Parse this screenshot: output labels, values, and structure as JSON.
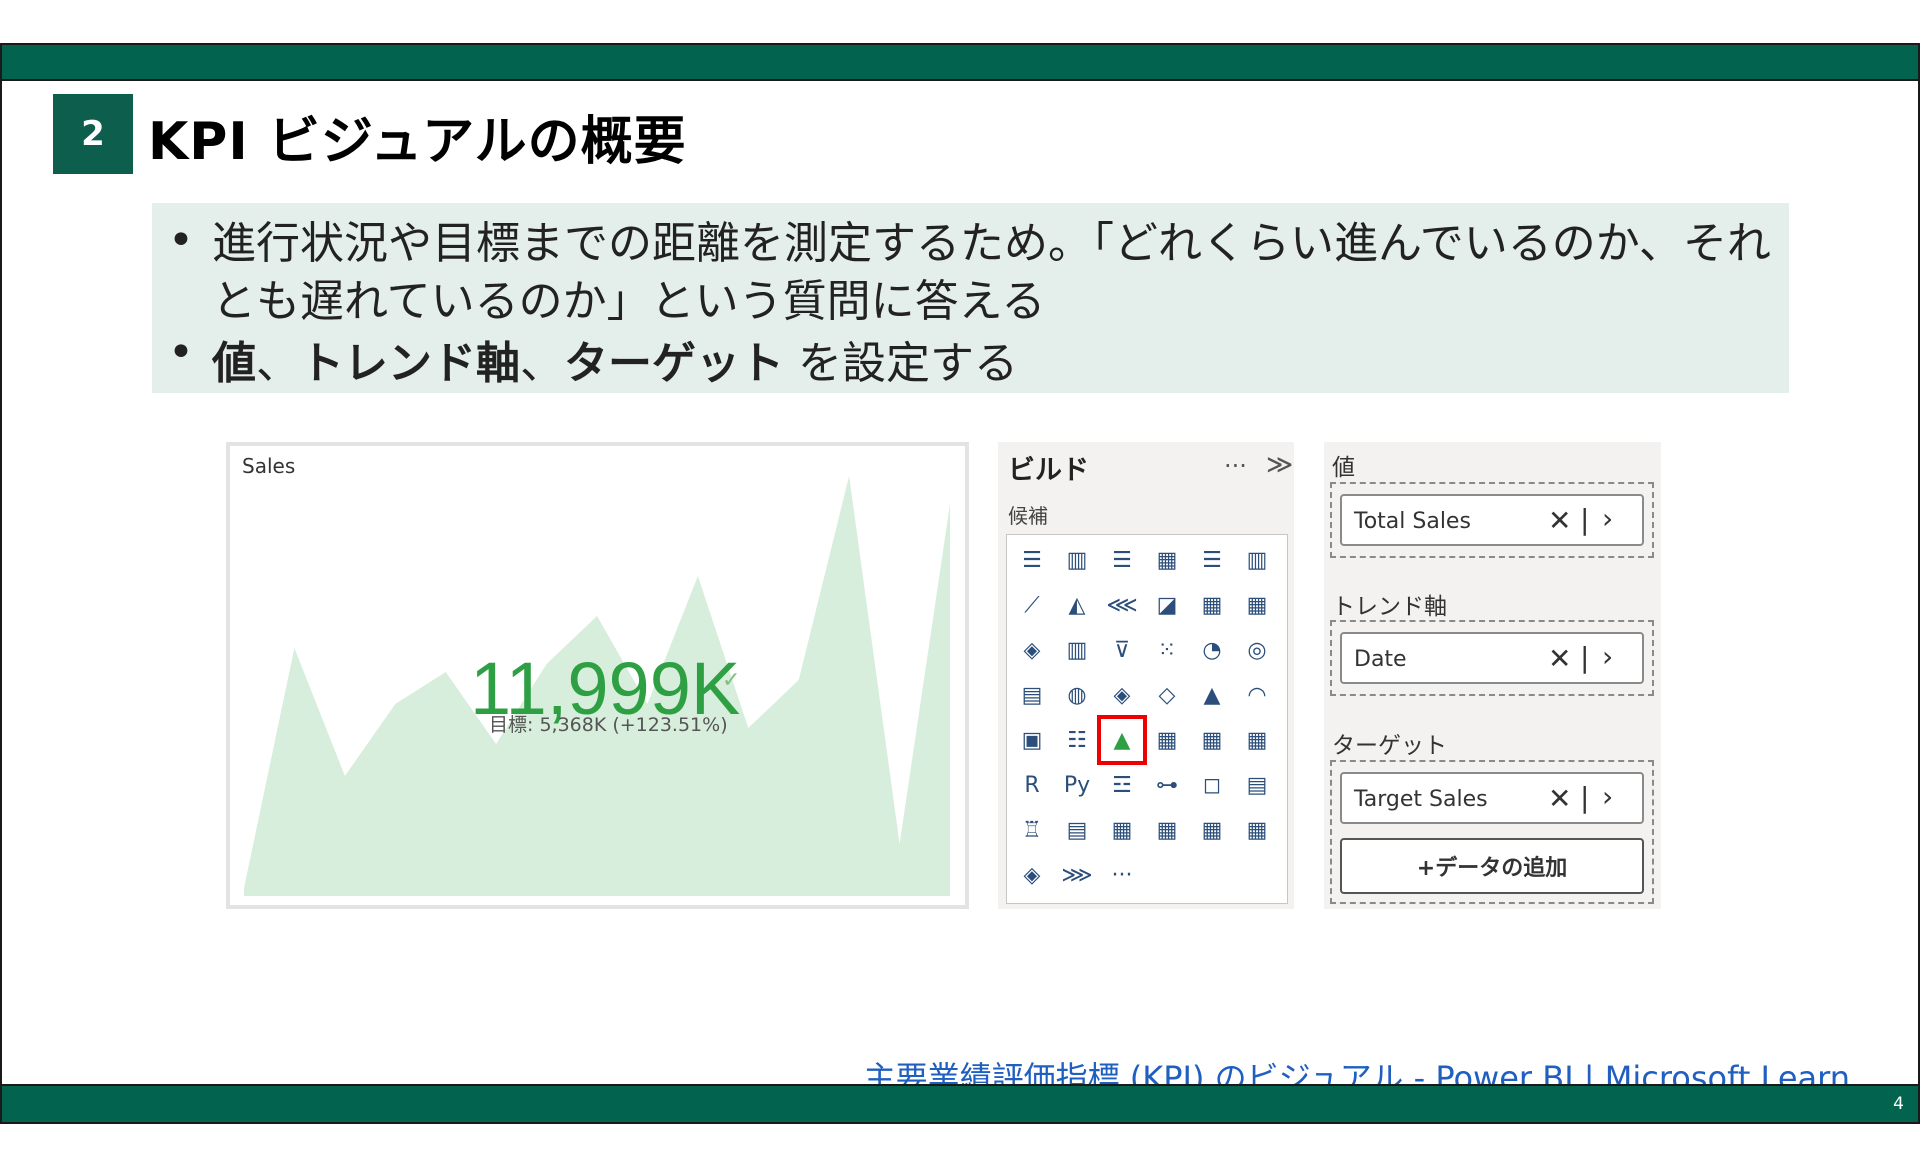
{
  "slide": {
    "section_number": "2",
    "title": "KPI ビジュアルの概要",
    "page_number": "4"
  },
  "bullets": {
    "line1": "進行状況や目標までの距離を測定するため。「どれくらい進んでいるのか、それとも遅れているのか」という質問に答える",
    "line2_parts": {
      "value": "値",
      "sep1": "、",
      "trend": "トレンド軸",
      "sep2": "、",
      "target": "ターゲット",
      "rest": " を設定する"
    },
    "dot": "•"
  },
  "kpi_visual": {
    "title": "Sales",
    "value": "11,999K",
    "check": "✓",
    "goal": "目標: 5,368K (+123.51%)",
    "area_color": "#d6eedb",
    "value_color": "#2ea043"
  },
  "chart_data": {
    "type": "area",
    "x": [
      0,
      1,
      2,
      3,
      4,
      5,
      6,
      7,
      8,
      9,
      10,
      11,
      12,
      13,
      14
    ],
    "values": [
      0.02,
      0.62,
      0.3,
      0.48,
      0.56,
      0.38,
      0.58,
      0.7,
      0.48,
      0.8,
      0.42,
      0.54,
      1.05,
      0.13,
      0.98
    ],
    "title": "Sales",
    "xlabel": "",
    "ylabel": "",
    "grid": false
  },
  "build_pane": {
    "title": "ビルド",
    "more": "···",
    "expand": "≫",
    "section_label": "候補",
    "icons": [
      "stacked-bar-icon",
      "clustered-column-icon",
      "stacked-bar-100-icon",
      "stacked-column-icon",
      "clustered-bar-icon",
      "column-100-icon",
      "line-chart-icon",
      "area-chart-icon",
      "stacked-area-icon",
      "area-100-icon",
      "line-column-icon",
      "line-clustered-column-icon",
      "ribbon-chart-icon",
      "waterfall-icon",
      "funnel-icon",
      "scatter-icon",
      "pie-icon",
      "donut-icon",
      "treemap-icon",
      "map-icon",
      "filled-map-icon",
      "shape-map-icon",
      "azure-map-icon",
      "gauge-icon",
      "card-icon",
      "multirow-card-icon",
      "kpi-icon",
      "slicer-icon",
      "table-icon",
      "matrix-icon",
      "r-visual-icon",
      "python-visual-icon",
      "key-influencers-icon",
      "decomposition-tree-icon",
      "qa-icon",
      "narrative-icon",
      "goals-icon",
      "paginated-report-icon",
      "power-apps-icon",
      "smart-narrative-icon",
      "power-automate-icon",
      "custom-visual-icon",
      "power-apps-diamond-icon",
      "power-automate-chevron-icon",
      "more-visuals-icon"
    ],
    "glyphs": [
      "☰",
      "▥",
      "☰",
      "▦",
      "☰",
      "▥",
      "⟋",
      "◭",
      "⋘",
      "◪",
      "▦",
      "▦",
      "◈",
      "▥",
      "⊽",
      "⁙",
      "◔",
      "◎",
      "▤",
      "◍",
      "◈",
      "◇",
      "▲",
      "◠",
      "▣",
      "☷",
      "▲",
      "▦",
      "▦",
      "▦",
      "R",
      "Py",
      "☲",
      "⊶",
      "◻",
      "▤",
      "♖",
      "▤",
      "▦",
      "▦",
      "▦",
      "▦",
      "◈",
      "⋙",
      "···"
    ]
  },
  "fields_pane": {
    "value_label": "値",
    "value_field": "Total Sales",
    "trend_label": "トレンド軸",
    "trend_field": "Date",
    "target_label": "ターゲット",
    "target_field": "Target Sales",
    "add_data": "+データの追加",
    "remove_glyph": "✕",
    "sep_glyph": "|",
    "expand_glyph": "›"
  },
  "link": {
    "text": "主要業績評価指標 (KPI) のビジュアル - Power BI | Microsoft Learn"
  },
  "colors": {
    "brand_green": "#02634f",
    "bullet_bg": "#e4eeeb",
    "link_blue": "#1f5fbf",
    "selection_red": "#e00000"
  }
}
